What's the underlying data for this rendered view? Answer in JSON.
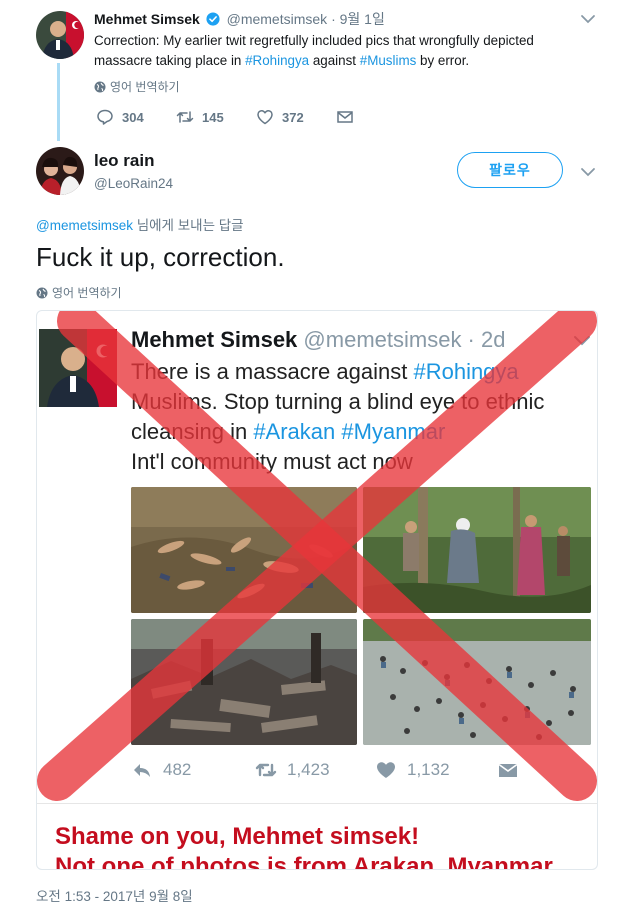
{
  "parent_tweet": {
    "name": "Mehmet Simsek",
    "handle": "@memetsimsek",
    "date": "· 9월 1일",
    "text_before": "Correction: My earlier twit regretfully included pics that wrongfully depicted massacre taking place in ",
    "hashtag1": "#Rohingya",
    "text_middle": " against ",
    "hashtag2": "#Muslims",
    "text_after": " by error.",
    "translate": "영어 번역하기",
    "reply_count": "304",
    "retweet_count": "145",
    "like_count": "372",
    "icons": [
      "reply-icon",
      "retweet-icon",
      "heart-icon",
      "message-icon",
      "verified-icon",
      "chevron-down-icon"
    ]
  },
  "reply_tweet": {
    "name": "leo rain",
    "handle": "@LeoRain24",
    "follow_label": "팔로우",
    "replying_to_handle": "@memetsimsek",
    "replying_to_suffix": " 님에게 보내는 답글",
    "text": "Fuck it up, correction.",
    "translate": "영어 번역하기"
  },
  "embedded_image": {
    "name": "Mehmet Simsek",
    "handle": "@memetsimsek · 2d",
    "text_line1_plain": "There is a massacre against ",
    "text_line1_tag": "#Rohingya",
    "text_line2": "Muslims. Stop turning a blind eye to ethnic",
    "text_line3_plain": "cleansing in ",
    "text_line3_tag1": "#Arakan",
    "text_line3_tag2": "#Myanmar",
    "text_line4": "Int'l community must act now",
    "reply_count": "482",
    "retweet_count": "1,423",
    "like_count": "1,132",
    "caption1": "Shame on you, Mehmet simsek!",
    "caption2": "Not one of photos is from Arakan, Myanmar"
  },
  "timestamp": "오전 1:53 - 2017년 9월 8일",
  "colors": {
    "accent": "#1da1f2",
    "link": "#1b95e0",
    "muted": "#657786",
    "thread_line": "#a9dbf5",
    "red_x": "#e8353a",
    "caption_red": "#c40d1e"
  }
}
